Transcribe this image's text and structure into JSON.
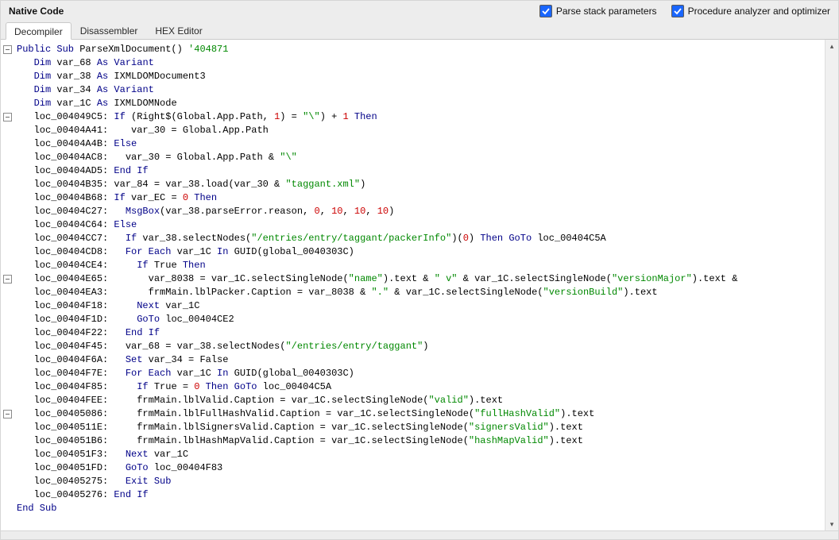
{
  "header": {
    "title": "Native Code",
    "check_parse_stack": {
      "checked": true,
      "label": "Parse stack parameters"
    },
    "check_optimizer": {
      "checked": true,
      "label": "Procedure analyzer and optimizer"
    }
  },
  "tabs": [
    {
      "id": "decompiler",
      "label": "Decompiler",
      "active": true
    },
    {
      "id": "disassembler",
      "label": "Disassembler",
      "active": false
    },
    {
      "id": "hex",
      "label": "HEX Editor",
      "active": false
    }
  ],
  "fold_lines": [
    0,
    5,
    17,
    27
  ],
  "code_lines": [
    [
      {
        "t": "kw",
        "v": "Public Sub"
      },
      {
        "t": "",
        "v": " ParseXmlDocument() "
      },
      {
        "t": "cmt",
        "v": "'404871"
      }
    ],
    [
      {
        "t": "",
        "v": "   "
      },
      {
        "t": "kw",
        "v": "Dim"
      },
      {
        "t": "",
        "v": " var_68 "
      },
      {
        "t": "kw",
        "v": "As Variant"
      }
    ],
    [
      {
        "t": "",
        "v": "   "
      },
      {
        "t": "kw",
        "v": "Dim"
      },
      {
        "t": "",
        "v": " var_38 "
      },
      {
        "t": "kw",
        "v": "As"
      },
      {
        "t": "",
        "v": " IXMLDOMDocument3"
      }
    ],
    [
      {
        "t": "",
        "v": "   "
      },
      {
        "t": "kw",
        "v": "Dim"
      },
      {
        "t": "",
        "v": " var_34 "
      },
      {
        "t": "kw",
        "v": "As Variant"
      }
    ],
    [
      {
        "t": "",
        "v": "   "
      },
      {
        "t": "kw",
        "v": "Dim"
      },
      {
        "t": "",
        "v": " var_1C "
      },
      {
        "t": "kw",
        "v": "As"
      },
      {
        "t": "",
        "v": " IXMLDOMNode"
      }
    ],
    [
      {
        "t": "",
        "v": "   loc_004049C5: "
      },
      {
        "t": "kw",
        "v": "If"
      },
      {
        "t": "",
        "v": " (Right$(Global.App.Path, "
      },
      {
        "t": "num",
        "v": "1"
      },
      {
        "t": "",
        "v": ") = "
      },
      {
        "t": "str",
        "v": "\"\\\""
      },
      {
        "t": "",
        "v": ") + "
      },
      {
        "t": "num",
        "v": "1"
      },
      {
        "t": "",
        "v": " "
      },
      {
        "t": "kw",
        "v": "Then"
      }
    ],
    [
      {
        "t": "",
        "v": "   loc_00404A41:    var_30 = Global.App.Path"
      }
    ],
    [
      {
        "t": "",
        "v": "   loc_00404A4B: "
      },
      {
        "t": "kw",
        "v": "Else"
      }
    ],
    [
      {
        "t": "",
        "v": "   loc_00404AC8:   var_30 = Global.App.Path & "
      },
      {
        "t": "str",
        "v": "\"\\\""
      }
    ],
    [
      {
        "t": "",
        "v": "   loc_00404AD5: "
      },
      {
        "t": "kw",
        "v": "End If"
      }
    ],
    [
      {
        "t": "",
        "v": "   loc_00404B35: var_84 = var_38.load(var_30 & "
      },
      {
        "t": "str",
        "v": "\"taggant.xml\""
      },
      {
        "t": "",
        "v": ")"
      }
    ],
    [
      {
        "t": "",
        "v": "   loc_00404B68: "
      },
      {
        "t": "kw",
        "v": "If"
      },
      {
        "t": "",
        "v": " var_EC = "
      },
      {
        "t": "num",
        "v": "0"
      },
      {
        "t": "",
        "v": " "
      },
      {
        "t": "kw",
        "v": "Then"
      }
    ],
    [
      {
        "t": "",
        "v": "   loc_00404C27:   "
      },
      {
        "t": "kw",
        "v": "MsgBox"
      },
      {
        "t": "",
        "v": "(var_38.parseError.reason, "
      },
      {
        "t": "num",
        "v": "0"
      },
      {
        "t": "",
        "v": ", "
      },
      {
        "t": "num",
        "v": "10"
      },
      {
        "t": "",
        "v": ", "
      },
      {
        "t": "num",
        "v": "10"
      },
      {
        "t": "",
        "v": ", "
      },
      {
        "t": "num",
        "v": "10"
      },
      {
        "t": "",
        "v": ")"
      }
    ],
    [
      {
        "t": "",
        "v": "   loc_00404C64: "
      },
      {
        "t": "kw",
        "v": "Else"
      }
    ],
    [
      {
        "t": "",
        "v": "   loc_00404CC7:   "
      },
      {
        "t": "kw",
        "v": "If"
      },
      {
        "t": "",
        "v": " var_38.selectNodes("
      },
      {
        "t": "str",
        "v": "\"/entries/entry/taggant/packerInfo\""
      },
      {
        "t": "",
        "v": ")("
      },
      {
        "t": "num",
        "v": "0"
      },
      {
        "t": "",
        "v": ") "
      },
      {
        "t": "kw",
        "v": "Then GoTo"
      },
      {
        "t": "",
        "v": " loc_00404C5A"
      }
    ],
    [
      {
        "t": "",
        "v": "   loc_00404CD8:   "
      },
      {
        "t": "kw",
        "v": "For Each"
      },
      {
        "t": "",
        "v": " var_1C "
      },
      {
        "t": "kw",
        "v": "In"
      },
      {
        "t": "",
        "v": " GUID(global_0040303C)"
      }
    ],
    [
      {
        "t": "",
        "v": "   loc_00404CE4:     "
      },
      {
        "t": "kw",
        "v": "If"
      },
      {
        "t": "",
        "v": " True "
      },
      {
        "t": "kw",
        "v": "Then"
      }
    ],
    [
      {
        "t": "",
        "v": "   loc_00404E65:       var_8038 = var_1C.selectSingleNode("
      },
      {
        "t": "str",
        "v": "\"name\""
      },
      {
        "t": "",
        "v": ").text & "
      },
      {
        "t": "str",
        "v": "\" v\""
      },
      {
        "t": "",
        "v": " & var_1C.selectSingleNode("
      },
      {
        "t": "str",
        "v": "\"versionMajor\""
      },
      {
        "t": "",
        "v": ").text &"
      }
    ],
    [
      {
        "t": "",
        "v": "   loc_00404EA3:       frmMain.lblPacker.Caption = var_8038 & "
      },
      {
        "t": "str",
        "v": "\".\""
      },
      {
        "t": "",
        "v": " & var_1C.selectSingleNode("
      },
      {
        "t": "str",
        "v": "\"versionBuild\""
      },
      {
        "t": "",
        "v": ").text"
      }
    ],
    [
      {
        "t": "",
        "v": "   loc_00404F18:     "
      },
      {
        "t": "kw",
        "v": "Next"
      },
      {
        "t": "",
        "v": " var_1C"
      }
    ],
    [
      {
        "t": "",
        "v": "   loc_00404F1D:     "
      },
      {
        "t": "kw",
        "v": "GoTo"
      },
      {
        "t": "",
        "v": " loc_00404CE2"
      }
    ],
    [
      {
        "t": "",
        "v": "   loc_00404F22:   "
      },
      {
        "t": "kw",
        "v": "End If"
      }
    ],
    [
      {
        "t": "",
        "v": "   loc_00404F45:   var_68 = var_38.selectNodes("
      },
      {
        "t": "str",
        "v": "\"/entries/entry/taggant\""
      },
      {
        "t": "",
        "v": ")"
      }
    ],
    [
      {
        "t": "",
        "v": "   loc_00404F6A:   "
      },
      {
        "t": "kw",
        "v": "Set"
      },
      {
        "t": "",
        "v": " var_34 = False"
      }
    ],
    [
      {
        "t": "",
        "v": "   loc_00404F7E:   "
      },
      {
        "t": "kw",
        "v": "For Each"
      },
      {
        "t": "",
        "v": " var_1C "
      },
      {
        "t": "kw",
        "v": "In"
      },
      {
        "t": "",
        "v": " GUID(global_0040303C)"
      }
    ],
    [
      {
        "t": "",
        "v": "   loc_00404F85:     "
      },
      {
        "t": "kw",
        "v": "If"
      },
      {
        "t": "",
        "v": " True = "
      },
      {
        "t": "num",
        "v": "0"
      },
      {
        "t": "",
        "v": " "
      },
      {
        "t": "kw",
        "v": "Then GoTo"
      },
      {
        "t": "",
        "v": " loc_00404C5A"
      }
    ],
    [
      {
        "t": "",
        "v": "   loc_00404FEE:     frmMain.lblValid.Caption = var_1C.selectSingleNode("
      },
      {
        "t": "str",
        "v": "\"valid\""
      },
      {
        "t": "",
        "v": ").text"
      }
    ],
    [
      {
        "t": "",
        "v": "   loc_00405086:     frmMain.lblFullHashValid.Caption = var_1C.selectSingleNode("
      },
      {
        "t": "str",
        "v": "\"fullHashValid\""
      },
      {
        "t": "",
        "v": ").text"
      }
    ],
    [
      {
        "t": "",
        "v": "   loc_0040511E:     frmMain.lblSignersValid.Caption = var_1C.selectSingleNode("
      },
      {
        "t": "str",
        "v": "\"signersValid\""
      },
      {
        "t": "",
        "v": ").text"
      }
    ],
    [
      {
        "t": "",
        "v": "   loc_004051B6:     frmMain.lblHashMapValid.Caption = var_1C.selectSingleNode("
      },
      {
        "t": "str",
        "v": "\"hashMapValid\""
      },
      {
        "t": "",
        "v": ").text"
      }
    ],
    [
      {
        "t": "",
        "v": "   loc_004051F3:   "
      },
      {
        "t": "kw",
        "v": "Next"
      },
      {
        "t": "",
        "v": " var_1C"
      }
    ],
    [
      {
        "t": "",
        "v": "   loc_004051FD:   "
      },
      {
        "t": "kw",
        "v": "GoTo"
      },
      {
        "t": "",
        "v": " loc_00404F83"
      }
    ],
    [
      {
        "t": "",
        "v": "   loc_00405275:   "
      },
      {
        "t": "kw",
        "v": "Exit Sub"
      }
    ],
    [
      {
        "t": "",
        "v": "   loc_00405276: "
      },
      {
        "t": "kw",
        "v": "End If"
      }
    ],
    [
      {
        "t": "kw",
        "v": "End Sub"
      }
    ]
  ],
  "scroll": {
    "up": "▴",
    "down": "▾"
  }
}
